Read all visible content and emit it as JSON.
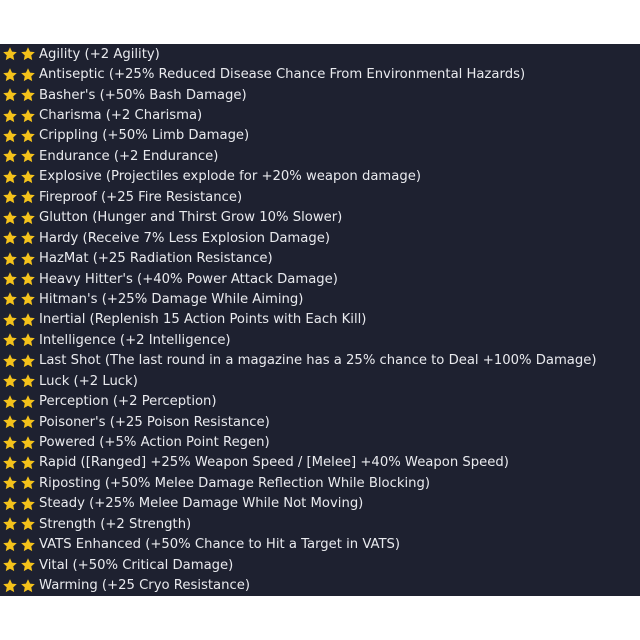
{
  "star_color": "#f4c21b",
  "star_icon": "star-icon",
  "panel_background": "#1e2130",
  "text_color": "#e9eaee",
  "perks": [
    "Agility (+2 Agility)",
    "Antiseptic (+25% Reduced Disease Chance From Environmental Hazards)",
    "Basher's (+50% Bash Damage)",
    "Charisma (+2 Charisma)",
    "Crippling (+50% Limb Damage)",
    "Endurance (+2 Endurance)",
    "Explosive (Projectiles explode for +20% weapon damage)",
    "Fireproof (+25 Fire Resistance)",
    "Glutton (Hunger and Thirst Grow 10% Slower)",
    "Hardy (Receive 7% Less Explosion Damage)",
    "HazMat (+25 Radiation Resistance)",
    "Heavy Hitter's (+40% Power Attack Damage)",
    "Hitman's (+25% Damage While Aiming)",
    "Inertial (Replenish 15 Action Points with Each Kill)",
    "Intelligence (+2 Intelligence)",
    "Last Shot (The last round in a magazine has a 25% chance to Deal +100% Damage)",
    "Luck (+2 Luck)",
    "Perception (+2 Perception)",
    "Poisoner's (+25 Poison Resistance)",
    "Powered (+5% Action Point Regen)",
    "Rapid ([Ranged] +25% Weapon Speed / [Melee] +40% Weapon Speed)",
    "Riposting (+50% Melee Damage Reflection While Blocking)",
    "Steady (+25% Melee Damage While Not Moving)",
    "Strength (+2 Strength)",
    "VATS Enhanced (+50% Chance to Hit a Target in VATS)",
    "Vital (+50% Critical Damage)",
    "Warming (+25 Cryo Resistance)"
  ]
}
